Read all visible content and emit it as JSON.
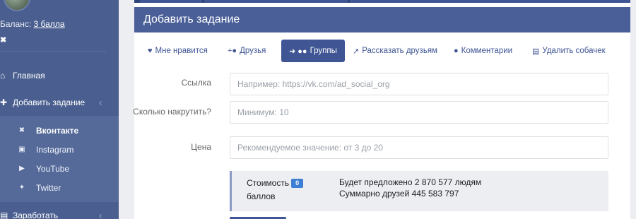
{
  "sidebar": {
    "balance_label": "Баланс:",
    "balance_value": "3 балла",
    "mini_icon": "vk-icon",
    "items": [
      {
        "label": "Главная",
        "icon": "home-icon"
      },
      {
        "label": "Добавить задание",
        "icon": "plus-icon"
      },
      {
        "label": "Заработать",
        "icon": "wallet-icon"
      }
    ],
    "submenu": [
      {
        "label": "Вконтакте",
        "icon": "vk-icon",
        "active": true
      },
      {
        "label": "Instagram",
        "icon": "instagram-icon"
      },
      {
        "label": "YouTube",
        "icon": "youtube-icon"
      },
      {
        "label": "Twitter",
        "icon": "twitter-icon"
      }
    ]
  },
  "panel": {
    "title": "Добавить задание"
  },
  "tabs": [
    {
      "label": "Мне нравится",
      "icon": "heart-icon"
    },
    {
      "label": "Друзья",
      "icon": "add-user-icon"
    },
    {
      "label": "Группы",
      "icon": "group-icon",
      "active": true
    },
    {
      "label": "Рассказать друзьям",
      "icon": "share-icon"
    },
    {
      "label": "Комментарии",
      "icon": "comments-icon"
    },
    {
      "label": "Удалить собачек",
      "icon": "trash-icon"
    }
  ],
  "form": {
    "link_label": "Ссылка",
    "link_placeholder": "Например: https://vk.com/ad_social_org",
    "count_label": "Сколько накрутить?",
    "count_placeholder": "Минимум: 10",
    "price_label": "Цена",
    "price_placeholder": "Рекомендуемое значение: от 3 до 20"
  },
  "summary": {
    "cost_label_1": "Стоимость",
    "cost_value": "0",
    "cost_label_2": "баллов",
    "offered_line": "Будет предложено 2 870 577 людям",
    "friends_line": "Суммарно друзей 445 583 797"
  },
  "colors": {
    "sidebar": "#4a5f8f",
    "accent": "#3f5594",
    "badge": "#3e7fd6"
  }
}
